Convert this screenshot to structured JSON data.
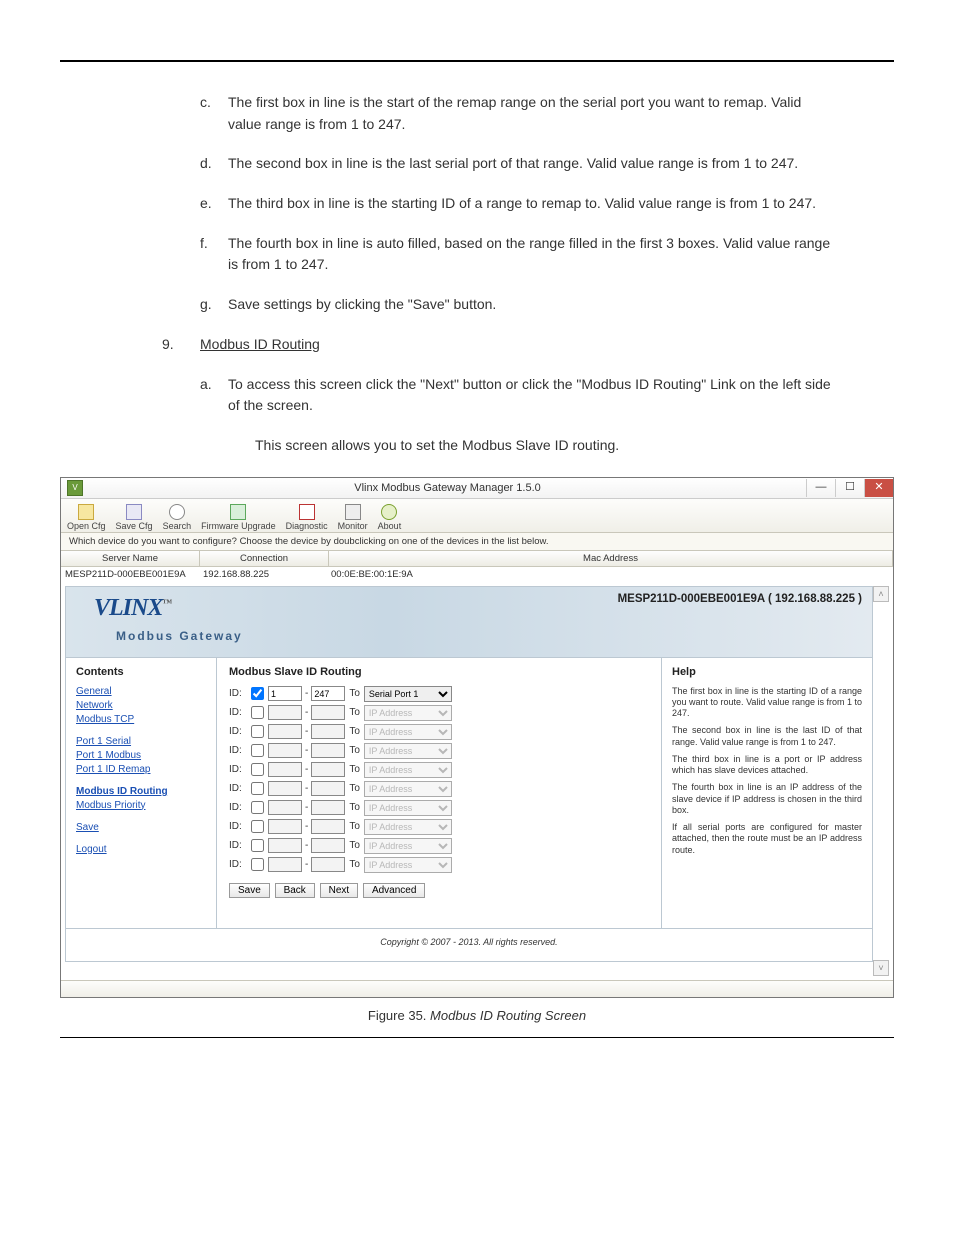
{
  "doc": {
    "items": {
      "c": "The first box in line is the start of the remap range on the serial port you want to remap. Valid value range is from 1 to 247.",
      "d": "The second box in line is the last serial port of that range. Valid value range is from 1 to 247.",
      "e": "The third box in line is the starting ID of a range to remap to. Valid value range is from 1 to 247.",
      "f": "The fourth box in line is auto filled, based on the range filled in the first 3 boxes. Valid value range is from 1 to 247.",
      "g": "Save settings by clicking the \"Save\" button."
    },
    "section9": {
      "num": "9.",
      "title": "Modbus ID Routing",
      "a": "To access this screen click the \"Next\" button or click the \"Modbus ID Routing\" Link on the left side of the screen.",
      "sub": "This screen allows you to set the Modbus Slave ID routing."
    },
    "caption_prefix": "Figure 35. ",
    "caption_em": "Modbus ID Routing Screen"
  },
  "app": {
    "title": "Vlinx Modbus Gateway Manager 1.5.0",
    "toolbar": {
      "open": "Open Cfg",
      "save": "Save Cfg",
      "search": "Search",
      "fw": "Firmware Upgrade",
      "diag": "Diagnostic",
      "mon": "Monitor",
      "about": "About"
    },
    "hint": "Which device do you want to configure? Choose the device by doubclicking on one of the devices in the list below.",
    "grid": {
      "h1": "Server Name",
      "h2": "Connection",
      "h3": "Mac Address",
      "r1c1": "MESP211D-000EBE001E9A",
      "r1c2": "192.168.88.225",
      "r1c3": "00:0E:BE:00:1E:9A"
    },
    "band": {
      "logo": "VLINX",
      "tm": "™",
      "sub": "Modbus Gateway",
      "device": "MESP211D-000EBE001E9A ( 192.168.88.225 )"
    },
    "nav": {
      "heading": "Contents",
      "general": "General",
      "network": "Network",
      "modbus_tcp": "Modbus TCP",
      "p1_serial": "Port 1 Serial",
      "p1_modbus": "Port 1 Modbus",
      "p1_remap": "Port 1 ID Remap",
      "id_routing": "Modbus ID Routing",
      "priority": "Modbus Priority",
      "save": "Save",
      "logout": "Logout"
    },
    "form": {
      "heading": "Modbus Slave ID Routing",
      "rows": [
        {
          "cb": true,
          "v1": "1",
          "v2": "247",
          "sel": "Serial Port 1",
          "dis": false
        },
        {
          "cb": false,
          "v1": "",
          "v2": "",
          "sel": "IP Address",
          "dis": true
        },
        {
          "cb": false,
          "v1": "",
          "v2": "",
          "sel": "IP Address",
          "dis": true
        },
        {
          "cb": false,
          "v1": "",
          "v2": "",
          "sel": "IP Address",
          "dis": true
        },
        {
          "cb": false,
          "v1": "",
          "v2": "",
          "sel": "IP Address",
          "dis": true
        },
        {
          "cb": false,
          "v1": "",
          "v2": "",
          "sel": "IP Address",
          "dis": true
        },
        {
          "cb": false,
          "v1": "",
          "v2": "",
          "sel": "IP Address",
          "dis": true
        },
        {
          "cb": false,
          "v1": "",
          "v2": "",
          "sel": "IP Address",
          "dis": true
        },
        {
          "cb": false,
          "v1": "",
          "v2": "",
          "sel": "IP Address",
          "dis": true
        },
        {
          "cb": false,
          "v1": "",
          "v2": "",
          "sel": "IP Address",
          "dis": true
        }
      ],
      "id_label": "ID:",
      "dash": "-",
      "to": "To",
      "btn_save": "Save",
      "btn_back": "Back",
      "btn_next": "Next",
      "btn_adv": "Advanced"
    },
    "help": {
      "heading": "Help",
      "p1": "The first box in line is the starting ID of a range you want to route. Valid value range is from 1 to 247.",
      "p2": "The second box in line is the last ID of that range. Valid value range is from 1 to 247.",
      "p3": "The third box in line is a port or IP address which has slave devices attached.",
      "p4": "The fourth box in line is an IP address of the slave device if IP address is chosen in the third box.",
      "p5": "If all serial ports are configured for master attached, then the route must be an IP address route."
    },
    "copyright": "Copyright © 2007 - 2013. All rights reserved."
  }
}
